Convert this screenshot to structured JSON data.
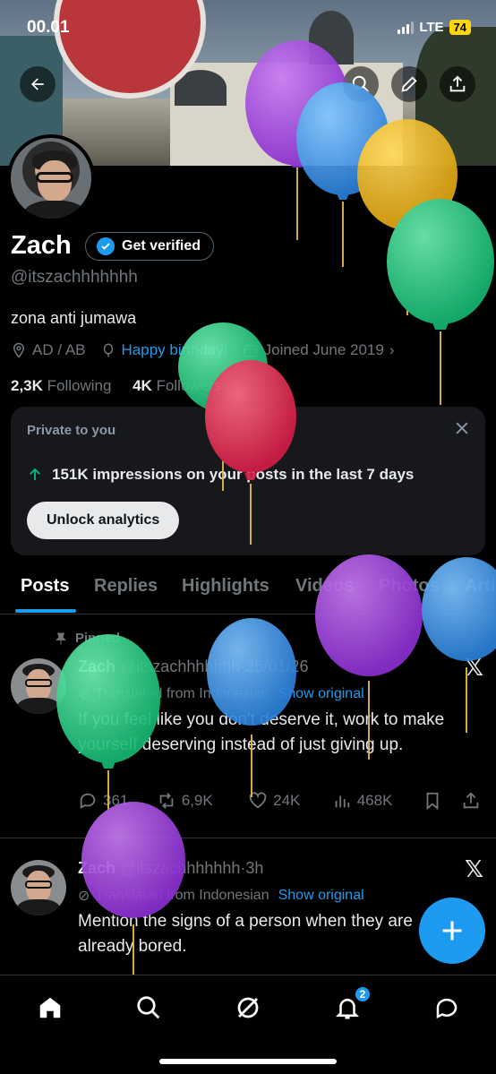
{
  "status_bar": {
    "time": "00.01",
    "network": "LTE",
    "battery": "74"
  },
  "profile": {
    "name": "Zach",
    "verify_label": "Get verified",
    "handle": "@itszachhhhhhh",
    "bio": "zona anti jumawa",
    "location": "AD / AB",
    "birthday": "Happy birthday!",
    "joined": "Joined June 2019",
    "following_count": "2,3K",
    "following_label": "Following",
    "followers_count": "4K",
    "followers_label": "Followers"
  },
  "private_card": {
    "title": "Private to you",
    "impressions": "151K impressions on your posts in the last 7 days",
    "unlock_label": "Unlock analytics"
  },
  "tabs": [
    "Posts",
    "Replies",
    "Highlights",
    "Videos",
    "Photos",
    "Articles"
  ],
  "posts": [
    {
      "pinned_label": "Pinned",
      "name": "Zach",
      "handle": "@itszachhhhhhh",
      "time": "25/01/26",
      "translated": "Translated from Indonesian",
      "show_original": "Show original",
      "text": "If you feel like you don't deserve it, work to make yourself deserving instead of just giving up.",
      "replies": "361",
      "reposts": "6,9K",
      "likes": "24K",
      "views": "468K"
    },
    {
      "name": "Zach",
      "handle": "@itszachhhhhhh",
      "time": "3h",
      "translated": "Translated from Indonesian",
      "show_original": "Show original",
      "text": "Mention the signs of a person when they are already bored.",
      "replies": "",
      "reposts": "",
      "likes": "",
      "views": ""
    }
  ],
  "nav": {
    "notification_count": "2"
  },
  "colors": {
    "accent": "#1d9bf0",
    "background": "#000000",
    "muted": "#71767b"
  }
}
